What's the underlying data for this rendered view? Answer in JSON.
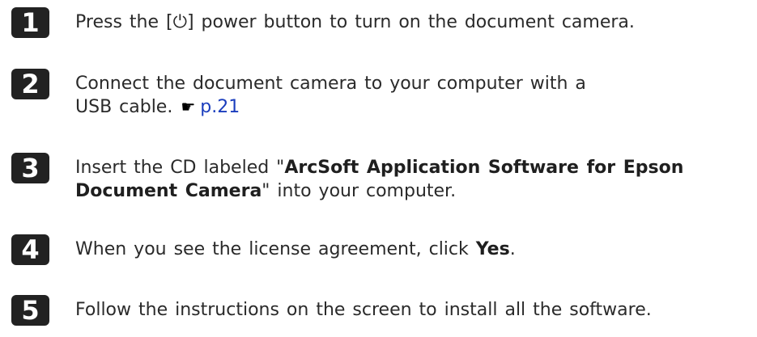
{
  "steps": [
    {
      "number": "1",
      "text_before": "Press the [",
      "power_symbol": "⏻",
      "text_after": "] power button to turn on the document camera."
    },
    {
      "number": "2",
      "text": "Connect the document camera to your computer with a USB cable.",
      "pointer_icon": "pointing-hand-icon",
      "link_text": "p.21"
    },
    {
      "number": "3",
      "text_before": "Insert the CD labeled \"",
      "bold_line1": "ArcSoft Application Software for Epson",
      "bold_line2": "Document Camera",
      "text_after": "\" into your computer."
    },
    {
      "number": "4",
      "text_before": "When you see the license agreement, click ",
      "bold": "Yes",
      "text_after": "."
    },
    {
      "number": "5",
      "text": "Follow the instructions on the screen to install all the software."
    }
  ],
  "colors": {
    "badge": "#222222",
    "link": "#1a3dbd"
  }
}
